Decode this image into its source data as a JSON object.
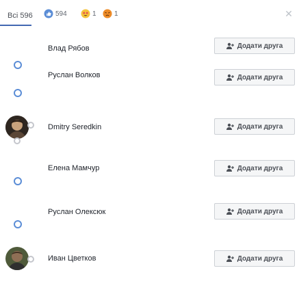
{
  "header": {
    "all_tab": "Всі 596",
    "filters": [
      {
        "icon": "like-reaction-icon",
        "count": "594",
        "color": "#5b8dd6"
      },
      {
        "icon": "love-reaction-icon",
        "count": "1",
        "color": "#f5c33b"
      },
      {
        "icon": "angry-reaction-icon",
        "count": "1",
        "color": "#e9710f"
      }
    ],
    "close_icon": "close-icon"
  },
  "people": [
    {
      "name": "Влад Рябов",
      "button": "Додати друга",
      "avatar": "empty"
    },
    {
      "name": "Руслан Волков",
      "button": "Додати друга",
      "avatar": "empty"
    },
    {
      "name": "Dmitry Seredkin",
      "button": "Додати друга",
      "avatar": "photo-brown"
    },
    {
      "name": "Елена Мамчур",
      "button": "Додати друга",
      "avatar": "empty"
    },
    {
      "name": "Руслан Олексюк",
      "button": "Додати друга",
      "avatar": "empty"
    },
    {
      "name": "Иван Цветков",
      "button": "Додати друга",
      "avatar": "photo-green"
    }
  ]
}
